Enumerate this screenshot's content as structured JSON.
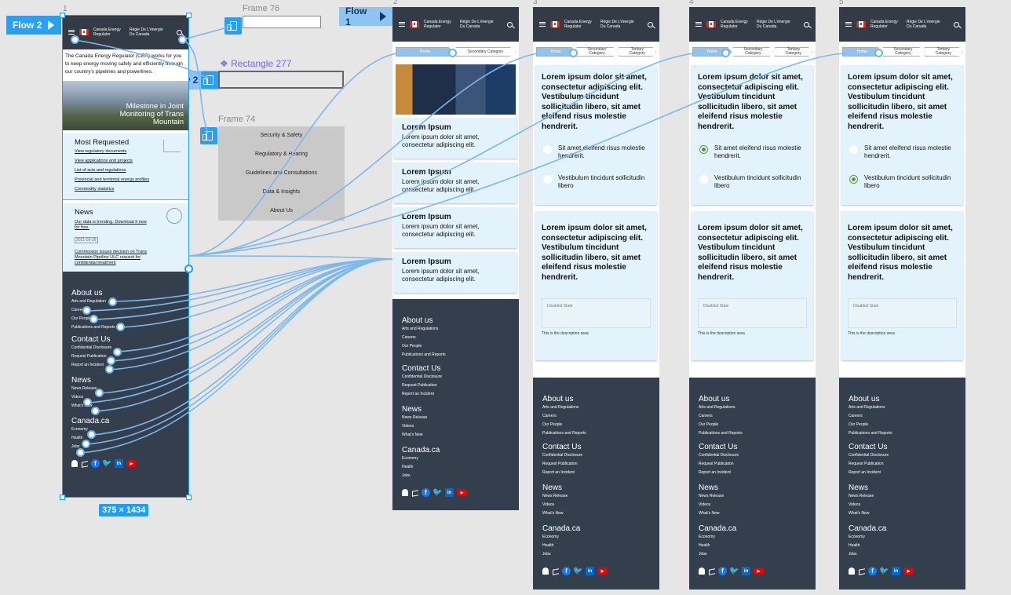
{
  "canvas": {
    "flow_labels": [
      "Flow 2",
      "Flow 2",
      "Flow 1"
    ],
    "frame76": "Frame 76",
    "frame74": "Frame 74",
    "rectangle": "❖ Rectangle 277",
    "dimension_badge": "375 × 1434",
    "frame_numbers": [
      "1",
      "2",
      "3",
      "4",
      "5"
    ]
  },
  "header": {
    "org_en": "Canada Energy Regulator",
    "org_fr": "Régie De L'énergie Du Canada"
  },
  "frame1": {
    "intro": "The Canada Energy Regulator (CER) works for you to keep energy moving safely and efficiently through our country's pipelines and powerlines.",
    "hero_caption": "Milestone in Joint Monitoring of Trans Mountain",
    "most_requested": {
      "title": "Most Requested",
      "links": [
        "View regulatory documents",
        "View applications and projects",
        "List of acts and regulations",
        "Provincial and territorial energy profiles",
        "Commodity statistics"
      ]
    },
    "news": {
      "title": "News",
      "items": [
        {
          "text": "Our data is trending. Download it now for free.",
          "date": "2021-05-25"
        },
        {
          "text": "Commission issues decision on Trans Mountain Pipeline ULC request for confidential treatment",
          "date": "2021-04-29"
        }
      ]
    }
  },
  "menu": {
    "items": [
      "Security & Safety",
      "Regulatory & Hearing",
      "Guidelines and Consultations",
      "Data & Insights",
      "About Us"
    ]
  },
  "breadcrumbs": {
    "home": "Home",
    "secondary": "Secondary Category",
    "tertiary": "Tertiary Category"
  },
  "cards": {
    "title": "Lorem Ipsum",
    "body": "Lorem ipsum dolor sit amet, consectetur adipiscing elit."
  },
  "question": {
    "q1": "Lorem ipsum dolor sit amet, consectetur adipiscing elit. Vestibulum tincidunt sollicitudin libero, sit amet eleifend risus molestie hendrerit.",
    "opt1": "Sit amet eleifend risus molestie hendrerit.",
    "opt2": "Vestibulum tincidunt sollicitudin libero",
    "q2": "Lorem ipsum dolor sit amet, consectetur adipiscing elit. Vestibulum tincidunt sollicitudin libero, sit amet eleifend risus molestie hendrerit.",
    "disabled_label": "Disabled State",
    "description": "This is the description area",
    "frame4_selected": 1,
    "frame5_selected": 2
  },
  "footer": {
    "about": {
      "title": "About us",
      "links": [
        "Arts and Regulations",
        "Careers",
        "Our People",
        "Publications and Reports"
      ]
    },
    "contact": {
      "title": "Contact Us",
      "links": [
        "Confidential Disclosure",
        "Request Publication",
        "Report an Incident"
      ]
    },
    "news": {
      "title": "News",
      "links": [
        "News Release",
        "Videos",
        "What's New"
      ]
    },
    "canada": {
      "title": "Canada.ca",
      "links": [
        "Economy",
        "Health",
        "Jobs"
      ]
    },
    "frame1_links": {
      "about": [
        "Arts and Regulation",
        "Careers",
        "Our People",
        "Publications and Reports"
      ],
      "contact": [
        "Confidential Disclosure",
        "Request Publication",
        "Report an Incident"
      ],
      "news": [
        "News Release",
        "Videos",
        "What's New"
      ],
      "canada": [
        "Economy",
        "Health",
        "Jobs"
      ]
    }
  },
  "colors": {
    "header": "#333c46",
    "card": "#e3f3fb",
    "flow": "#8fc3f2",
    "selection": "#18a0fb"
  }
}
